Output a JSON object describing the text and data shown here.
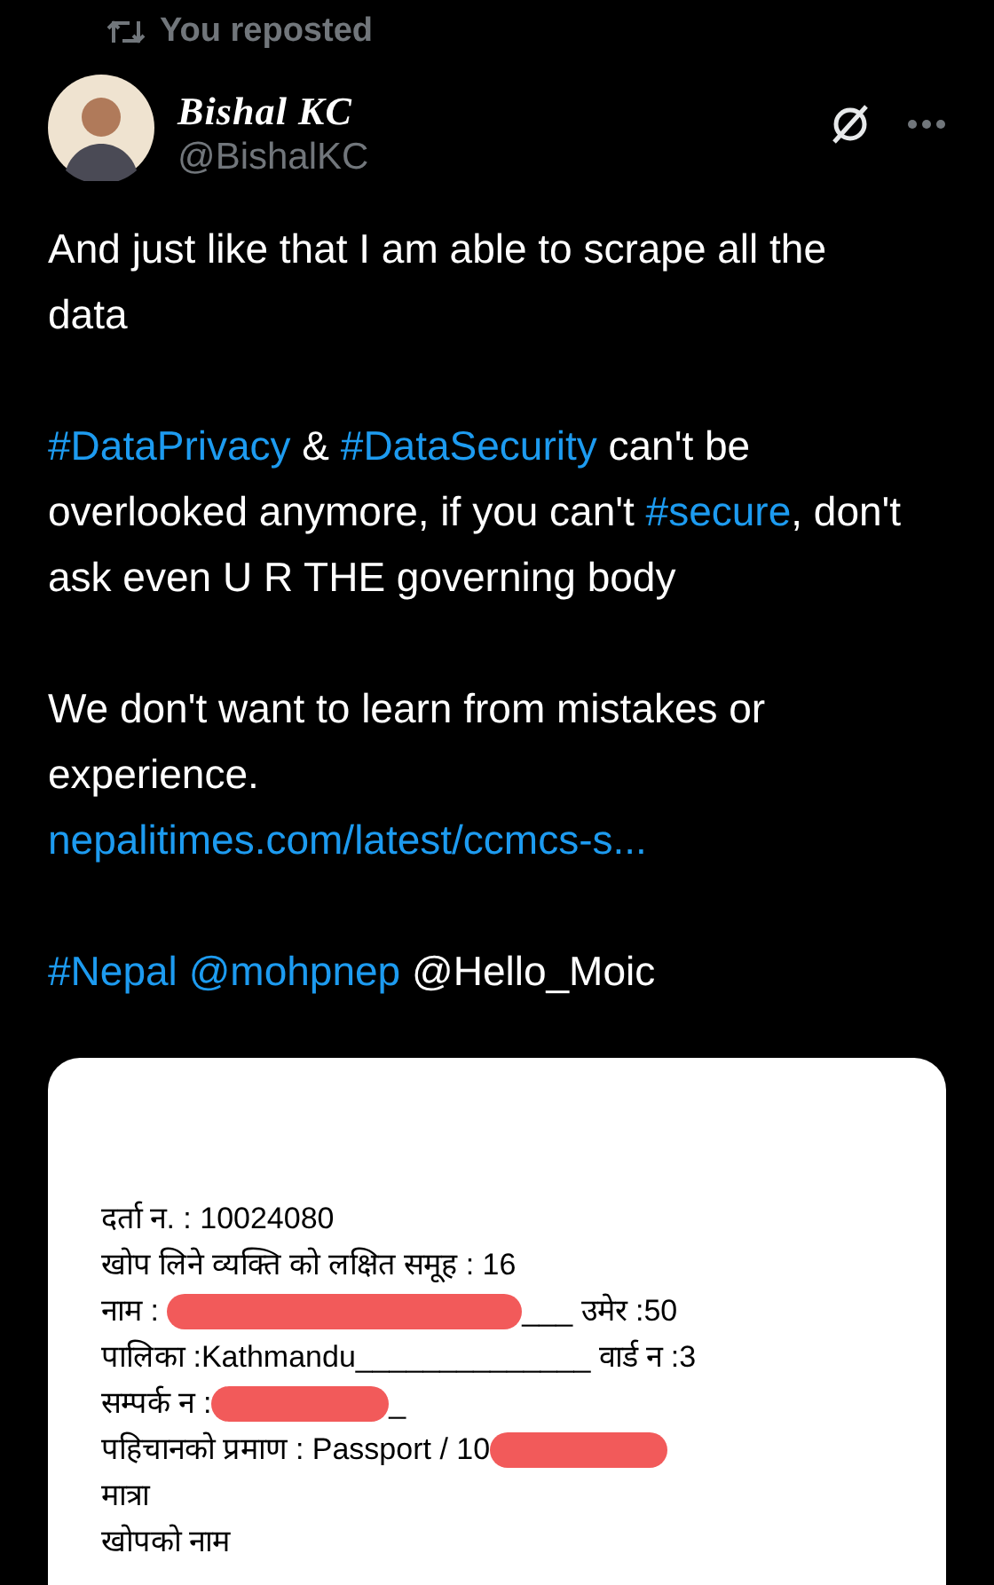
{
  "repost_header": {
    "label": "You reposted"
  },
  "author": {
    "name": "Bishal KC",
    "handle": "@BishalKC"
  },
  "body": [
    [
      {
        "kind": "text",
        "text": "And just like that I am able to scrape all the data"
      }
    ],
    [
      {
        "kind": "hashtag",
        "text": "#DataPrivacy"
      },
      {
        "kind": "text",
        "text": " & "
      },
      {
        "kind": "hashtag",
        "text": "#DataSecurity"
      },
      {
        "kind": "text",
        "text": " can't be overlooked anymore, if you can't "
      },
      {
        "kind": "hashtag",
        "text": "#secure"
      },
      {
        "kind": "text",
        "text": ", don't ask even U R THE governing body"
      }
    ],
    [
      {
        "kind": "text",
        "text": "We don't want to learn from mistakes or experience."
      },
      {
        "kind": "break"
      },
      {
        "kind": "link",
        "text": " nepalitimes.com/latest/ccmcs-s..."
      }
    ],
    [
      {
        "kind": "hashtag",
        "text": "#Nepal"
      },
      {
        "kind": "mention",
        "text": "@mohpnep"
      },
      {
        "kind": "text",
        "text": " @Hello_Moic"
      }
    ]
  ],
  "document": {
    "lines": [
      [
        {
          "kind": "text",
          "text": "दर्ता न. : 10024080"
        }
      ],
      [
        {
          "kind": "text",
          "text": "खोप लिने व्यक्ति को लक्षित समूह : 16"
        }
      ],
      [
        {
          "kind": "text",
          "text": "नाम : "
        },
        {
          "kind": "redaction"
        },
        {
          "kind": "text",
          "text": "___ उमेर :50"
        }
      ],
      [
        {
          "kind": "text",
          "text": "पालिका :Kathmandu______________ वार्ड न :3"
        }
      ],
      [
        {
          "kind": "text",
          "text": "सम्पर्क न :"
        },
        {
          "kind": "redaction"
        },
        {
          "kind": "text",
          "text": "_"
        }
      ],
      [
        {
          "kind": "text",
          "text": "पहिचानको प्रमाण : Passport / 10"
        },
        {
          "kind": "redaction"
        }
      ],
      [
        {
          "kind": "text",
          "text": "मात्रा"
        }
      ],
      [
        {
          "kind": "text",
          "text": "खोपको नाम"
        }
      ]
    ]
  }
}
